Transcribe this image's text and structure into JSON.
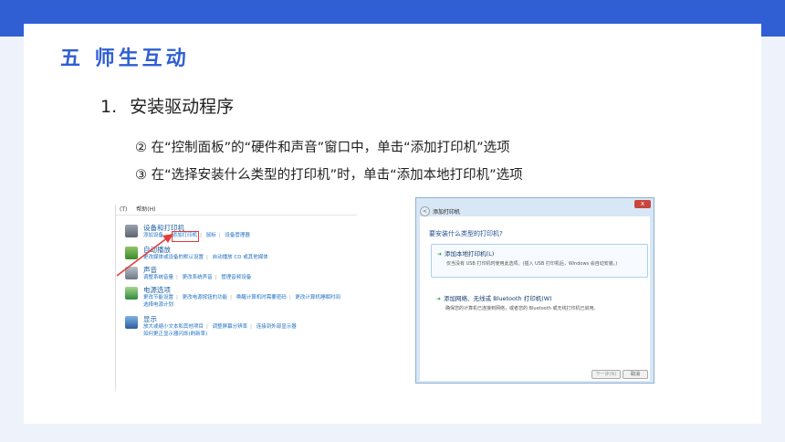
{
  "slide": {
    "title": "五 师生互动",
    "subtitle_num": "1.",
    "subtitle_text": "安装驱动程序",
    "step1": "② 在“控制面板”的“硬件和声音”窗口中，单击“添加打印机”选项",
    "step2": "③ 在“选择安装什么类型的打印机”时，单击“添加本地打印机”选项"
  },
  "control_panel": {
    "menu": [
      "(T)",
      "帮助(H)"
    ],
    "sections": [
      {
        "heading": "设备和打印机",
        "icon": "printer-icon",
        "links": [
          "添加设备",
          "添加打印机",
          "鼠标",
          "设备管理器"
        ]
      },
      {
        "heading": "自动播放",
        "icon": "autoplay-icon",
        "links": [
          "更改媒体或设备的默认设置",
          "自动播放 CD 或其他媒体"
        ]
      },
      {
        "heading": "声音",
        "icon": "speaker-icon",
        "links": [
          "调整系统音量",
          "更改系统声音",
          "管理音频设备"
        ]
      },
      {
        "heading": "电源选项",
        "icon": "power-icon",
        "links": [
          "更改节能设置",
          "更改电源按钮的功能",
          "唤醒计算机时需要密码",
          "更改计算机睡眠时间",
          "选择电源计划"
        ]
      },
      {
        "heading": "显示",
        "icon": "display-icon",
        "links": [
          "放大或缩小文本和其他项目",
          "调整屏幕分辨率",
          "连接到外部显示器",
          "如何更正显示器闪烁(刷新率)"
        ]
      }
    ]
  },
  "dialog": {
    "title": "添加打印机",
    "close": "x",
    "back": "<",
    "question": "要安装什么类型的打印机?",
    "option_local": {
      "label": "添加本地打印机(L)",
      "desc": "仅当没有 USB 打印机时使用此选项。(插入 USB 打印机后，Windows 会自动安装。)"
    },
    "option_network": {
      "label": "添加网络、无线或 Bluetooth 打印机(W)",
      "desc": "确保您的计算机已连接到网络，或者您的 Bluetooth 或无线打印机已启用。"
    },
    "next_button": "下一步(N)",
    "cancel_button": "取消"
  },
  "colors": {
    "accent": "#2f5fd3",
    "highlight": "#e23c3c"
  }
}
